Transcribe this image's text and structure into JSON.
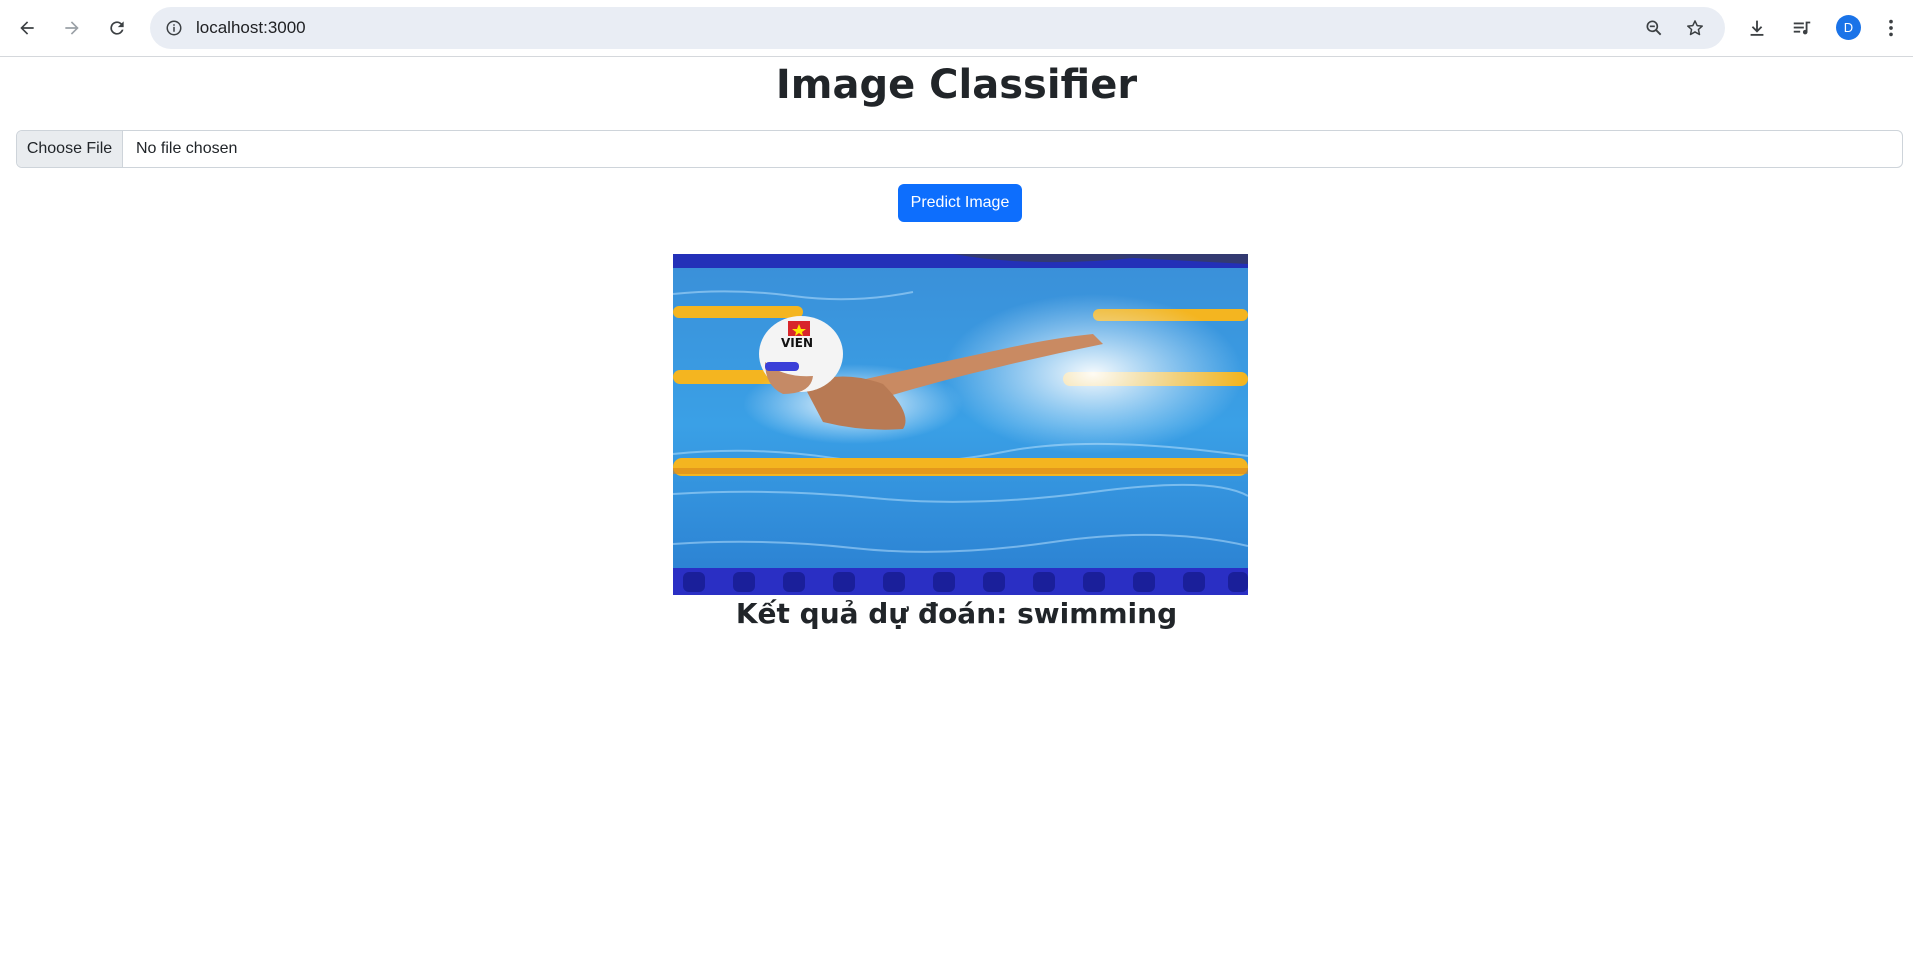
{
  "browser": {
    "url": "localhost:3000",
    "profile_initial": "D",
    "icons": {
      "back": "back-arrow-icon",
      "forward": "forward-arrow-icon",
      "reload": "reload-icon",
      "site_info": "info-icon",
      "zoom": "zoom-out-icon",
      "bookmark": "star-icon",
      "downloads": "download-icon",
      "media": "media-queue-icon",
      "menu": "kebab-menu-icon"
    },
    "accent_color": "#1a73e8"
  },
  "page": {
    "title": "Image Classifier",
    "file_input": {
      "button_label": "Choose File",
      "status_text": "No file chosen"
    },
    "predict_button_label": "Predict Image",
    "predict_button_color": "#0d6efd",
    "preview_image": {
      "cap_text": "VIEN"
    },
    "result_text": "Kết quả dự đoán: swimming"
  }
}
